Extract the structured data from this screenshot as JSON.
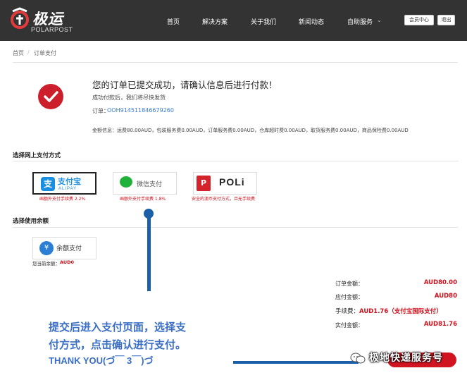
{
  "header": {
    "logo_cn": "极运",
    "logo_en": "POLARPOST",
    "nav": [
      {
        "label": "首页"
      },
      {
        "label": "解决方案"
      },
      {
        "label": "关于我们"
      },
      {
        "label": "新闻动态"
      },
      {
        "label": "自助服务"
      }
    ],
    "member_center": "会员中心",
    "logout": "退出"
  },
  "breadcrumb": {
    "home": "首页",
    "separator": "/",
    "current": "订单支付"
  },
  "success": {
    "title": "您的订单已提交成功，请确认信息后进行付款！",
    "subtitle": "成功付款后，我们将尽快发货",
    "order_label": "订单：",
    "order_no": "OOH9145118466792​60",
    "fees": "金额信息：运费80.00AUD，包装服务费0.00AUD，订单服务费0.00AUD，仓库超时费0.00AUD，取货服务费0.00AUD，商品保险费0.00AUD"
  },
  "online_payment": {
    "title": "选择网上支付方式",
    "methods": [
      {
        "name": "支付宝",
        "sub": "ALIPAY",
        "note": "画额外支付手续费 2.2%",
        "selected": true
      },
      {
        "name": "微信支付",
        "note": "画额外支付手续费 1.8%",
        "selected": false
      },
      {
        "name": "POLi",
        "note": "安全的澳币支付方式，且无手续费",
        "selected": false
      }
    ]
  },
  "balance": {
    "title": "选择使用余额",
    "method_name": "余额支付",
    "current_label": "您当前余额：",
    "current_value": "AUD0"
  },
  "totals": {
    "order_amount_label": "订单金额：",
    "order_amount": "AUD80.00",
    "payable_label": "应付金额：",
    "payable": "AUD80",
    "fee_label": "手续费：",
    "fee": "AUD1.76（支付宝国际支付）",
    "actual_label": "实付金额：",
    "actual": "AUD81.76"
  },
  "annotation": {
    "line1": "提交后进入支付页面，选择支",
    "line2": "付方式，点击确认进行支付。",
    "thanks": "THANK YOU(づ￣ 3￣)づ"
  },
  "watermark": "极地快递服务号",
  "colors": {
    "accent_red": "#d0101b",
    "header_bg": "#333333",
    "annotation_blue": "#3b6fc6",
    "alipay_blue": "#1a8ee0",
    "wechat_green": "#20b13b"
  },
  "icons": [
    "logo-mark-icon",
    "checkmark-icon",
    "alipay-icon",
    "wechat-icon",
    "poli-icon",
    "balance-coins-icon",
    "chevron-down-icon",
    "wechat-official-icon"
  ]
}
